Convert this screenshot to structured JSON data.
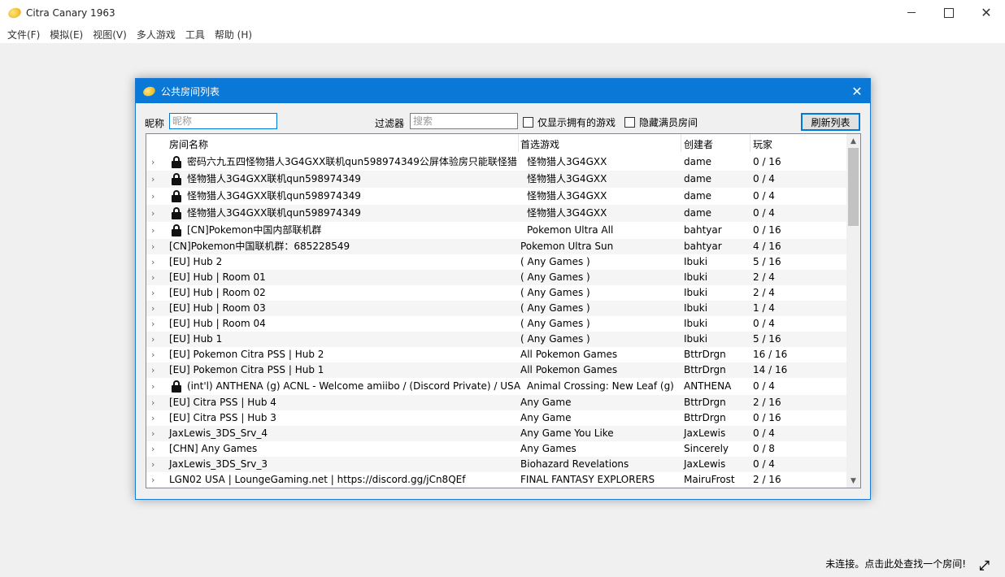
{
  "window": {
    "title": "Citra Canary 1963"
  },
  "menu": [
    "文件(F)",
    "模拟(E)",
    "视图(V)",
    "多人游戏",
    "工具",
    "帮助 (H)"
  ],
  "dialog": {
    "title": "公共房间列表",
    "nickname_label": "昵称",
    "nickname_placeholder": "昵称",
    "filter_label": "过滤器",
    "search_placeholder": "搜索",
    "only_owned_label": "仅显示拥有的游戏",
    "hide_full_label": "隐藏满员房间",
    "refresh_label": "刷新列表",
    "columns": [
      "房间名称",
      "首选游戏",
      "创建者",
      "玩家"
    ],
    "rows": [
      {
        "name": "密码六九五四怪物猎人3G4GXX联机qun598974349公屏体验房只能联怪猎",
        "game": "怪物猎人3G4GXX",
        "owner": "dame",
        "players": "0 / 16",
        "locked": true
      },
      {
        "name": "怪物猎人3G4GXX联机qun598974349",
        "game": "怪物猎人3G4GXX",
        "owner": "dame",
        "players": "0 / 4",
        "locked": true
      },
      {
        "name": " 怪物猎人3G4GXX联机qun598974349",
        "game": "怪物猎人3G4GXX",
        "owner": "dame",
        "players": "0 / 4",
        "locked": true
      },
      {
        "name": "怪物猎人3G4GXX联机qun598974349",
        "game": "怪物猎人3G4GXX",
        "owner": "dame",
        "players": "0 / 4",
        "locked": true
      },
      {
        "name": "[CN]Pokemon中国内部联机群",
        "game": "Pokemon Ultra All",
        "owner": "bahtyar",
        "players": "0 / 16",
        "locked": true
      },
      {
        "name": "[CN]Pokemon中国联机群：685228549",
        "game": "Pokemon Ultra Sun",
        "owner": "bahtyar",
        "players": "4 / 16",
        "locked": false
      },
      {
        "name": "[EU] Hub 2",
        "game": "( Any Games )",
        "owner": "Ibuki",
        "players": "5 / 16",
        "locked": false
      },
      {
        "name": "[EU] Hub | Room 01",
        "game": "( Any Games )",
        "owner": "Ibuki",
        "players": "2 / 4",
        "locked": false
      },
      {
        "name": "[EU] Hub | Room 02",
        "game": "( Any Games )",
        "owner": "Ibuki",
        "players": "2 / 4",
        "locked": false
      },
      {
        "name": "[EU] Hub | Room 03",
        "game": "( Any Games )",
        "owner": "Ibuki",
        "players": "1 / 4",
        "locked": false
      },
      {
        "name": "[EU] Hub | Room 04",
        "game": "( Any Games )",
        "owner": "Ibuki",
        "players": "0 / 4",
        "locked": false
      },
      {
        "name": "[EU] Hub 1",
        "game": "( Any Games )",
        "owner": "Ibuki",
        "players": "5 / 16",
        "locked": false
      },
      {
        "name": "[EU] Pokemon Citra PSS | Hub 2",
        "game": "All Pokemon Games",
        "owner": "BttrDrgn",
        "players": "16 / 16",
        "locked": false
      },
      {
        "name": "[EU] Pokemon Citra PSS | Hub 1",
        "game": "All Pokemon Games",
        "owner": "BttrDrgn",
        "players": "14 / 16",
        "locked": false
      },
      {
        "name": "(int'l) ANTHENA (g) ACNL - Welcome amiibo / (Discord Private) / USA",
        "game": "Animal Crossing: New Leaf (g)",
        "owner": "ANTHENA",
        "players": "0 / 4",
        "locked": true
      },
      {
        "name": "[EU] Citra PSS | Hub 4",
        "game": "Any Game",
        "owner": "BttrDrgn",
        "players": "2 / 16",
        "locked": false
      },
      {
        "name": "[EU] Citra PSS | Hub 3",
        "game": "Any Game",
        "owner": "BttrDrgn",
        "players": "0 / 16",
        "locked": false
      },
      {
        "name": "JaxLewis_3DS_Srv_4",
        "game": "Any Game You Like",
        "owner": "JaxLewis",
        "players": "0 / 4",
        "locked": false
      },
      {
        "name": "[CHN] Any Games",
        "game": "Any Games",
        "owner": "Sincerely",
        "players": "0 / 8",
        "locked": false
      },
      {
        "name": "JaxLewis_3DS_Srv_3",
        "game": "Biohazard Revelations",
        "owner": "JaxLewis",
        "players": "0 / 4",
        "locked": false
      },
      {
        "name": "LGN02 USA | LoungeGaming.net | https://discord.gg/jCn8QEf",
        "game": "FINAL FANTASY EXPLORERS",
        "owner": "MairuFrost",
        "players": "2 / 16",
        "locked": false
      }
    ]
  },
  "status": {
    "text": "未连接。点击此处查找一个房间!"
  }
}
